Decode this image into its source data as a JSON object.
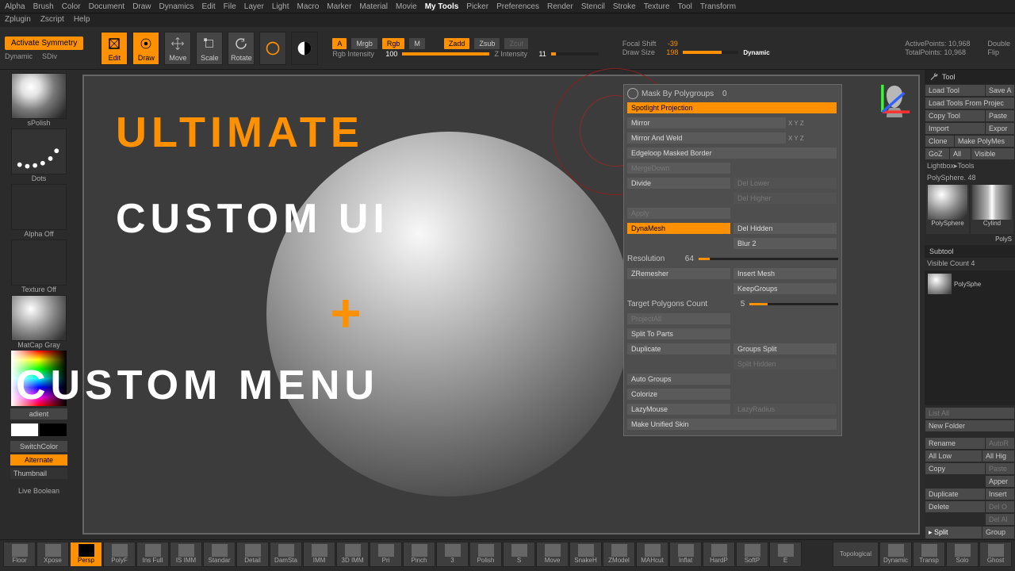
{
  "menubar": {
    "items": [
      "Alpha",
      "Brush",
      "Color",
      "Document",
      "Draw",
      "Dynamics",
      "Edit",
      "File",
      "Layer",
      "Light",
      "Macro",
      "Marker",
      "Material",
      "Movie",
      "My Tools",
      "Picker",
      "Preferences",
      "Render",
      "Stencil",
      "Stroke",
      "Texture",
      "Tool",
      "Transform"
    ],
    "row2": [
      "Zplugin",
      "Zscript",
      "Help"
    ],
    "active": "My Tools"
  },
  "toolbar": {
    "activate_symmetry": "Activate Symmetry",
    "dynamic": "Dynamic",
    "sdiv": "SDiv",
    "edit": "Edit",
    "draw": "Draw",
    "move": "Move",
    "scale": "Scale",
    "rotate": "Rotate",
    "a_label": "A",
    "mrgb": "Mrgb",
    "rgb": "Rgb",
    "m": "M",
    "zadd": "Zadd",
    "zsub": "Zsub",
    "zcut": "Zcut",
    "rgb_intensity_label": "Rgb Intensity",
    "rgb_intensity_value": "100",
    "z_intensity_label": "Z Intensity",
    "z_intensity_value": "11",
    "focal_shift_label": "Focal Shift",
    "focal_shift_value": "-39",
    "draw_size_label": "Draw Size",
    "draw_size_value": "198",
    "dynamic_toggle": "Dynamic",
    "active_points_label": "ActivePoints:",
    "active_points_value": "10,968",
    "total_points_label": "TotalPoints:",
    "total_points_value": "10,968",
    "double": "Double",
    "flip": "Flip"
  },
  "left_palette": {
    "spolish": "sPolish",
    "dots": "Dots",
    "alpha_off": "Alpha Off",
    "texture_off": "Texture Off",
    "matcap_gray": "MatCap Gray",
    "gradient": "adient",
    "switch_color": "SwitchColor",
    "alternate": "Alternate",
    "thumbnail": "Thumbnail",
    "live_boolean": "Live Boolean"
  },
  "overlay": {
    "ultimate": "ULTIMATE",
    "custom_ui": "CUSTOM UI",
    "plus": "+",
    "custom_menu": "CUSTOM MENU"
  },
  "popup": {
    "mask_by_polygroups": "Mask By Polygroups",
    "mask_by_polygroups_val": "0",
    "spotlight": "Spotlight Projection",
    "mirror": "Mirror",
    "mirror_weld": "Mirror And Weld",
    "edgeloop": "Edgeloop Masked Border",
    "mergedown": "MergeDown",
    "divide": "Divide",
    "del_lower": "Del Lower",
    "del_higher": "Del Higher",
    "apply": "Apply",
    "dynamesh": "DynaMesh",
    "del_hidden": "Del Hidden",
    "blur": "Blur",
    "blur_val": "2",
    "resolution": "Resolution",
    "resolution_val": "64",
    "zremesher": "ZRemesher",
    "insert_mesh": "Insert Mesh",
    "keep_groups": "KeepGroups",
    "target_polys": "Target Polygons Count",
    "target_polys_val": "5",
    "projectall": "ProjectAll",
    "split_parts": "Split To Parts",
    "duplicate": "Duplicate",
    "groups_split": "Groups Split",
    "split_hidden": "Split Hidden",
    "auto_groups": "Auto Groups",
    "colorize": "Colorize",
    "lazymouse": "LazyMouse",
    "lazyradius": "LazyRadius",
    "unified_skin": "Make Unified Skin",
    "xyz": "X Y Z"
  },
  "right": {
    "tool": "Tool",
    "load_tool": "Load Tool",
    "save": "Save A",
    "load_from_project": "Load Tools From Projec",
    "copy_tool": "Copy Tool",
    "paste": "Paste",
    "import": "Import",
    "export": "Expor",
    "clone": "Clone",
    "make_polymesh": "Make PolyMes",
    "goz": "GoZ",
    "all": "All",
    "visible": "Visible",
    "lightbox": "Lightbox▸Tools",
    "polysphere_label": "PolySphere.",
    "polysphere_val": "48",
    "polysphere": "PolySphere",
    "polys": "PolyS",
    "cylind": "Cylind",
    "subtool": "Subtool",
    "visible_count": "Visible Count",
    "visible_count_val": "4",
    "polysphere_item": "PolySphe",
    "list_all": "List All",
    "new_folder": "New Folder",
    "rename": "Rename",
    "autor": "AutoR",
    "all_low": "All Low",
    "all_hig": "All Hig",
    "copy": "Copy",
    "paste2": "Paste",
    "append": "Apper",
    "insert": "Insert",
    "dup": "Duplicate",
    "delete": "Delete",
    "del_o": "Del O",
    "del_al": "Del Al",
    "split": "Split",
    "groups": "Group"
  },
  "bottom": {
    "items": [
      "Floor",
      "Xpose",
      "Persp",
      "PolyF",
      "Ins Full",
      "IS IMM",
      "Standar",
      "Detail",
      "DamSta",
      "IMM",
      "3D IMM",
      "Pri",
      "Pinch",
      "3",
      "Polish",
      "S",
      "Move",
      "SnakeH",
      "ZModel",
      "MAHcut",
      "Inflat",
      "HardP",
      "SoftP",
      "E",
      "Topological",
      "Dynamic",
      "Transp",
      "Solo",
      "Ghost"
    ]
  }
}
